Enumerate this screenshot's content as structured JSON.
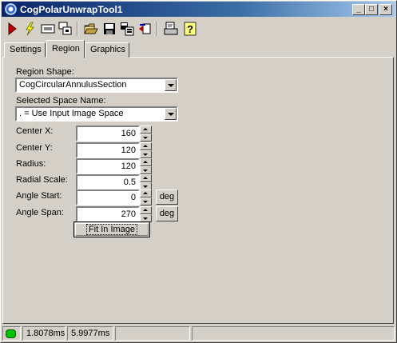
{
  "window": {
    "title": "CogPolarUnwrapTool1"
  },
  "caption_buttons": {
    "minimize": "_",
    "maximize": "□",
    "close": "×"
  },
  "toolbar": {
    "buttons": [
      {
        "name": "run-icon"
      },
      {
        "name": "electric-icon"
      },
      {
        "name": "image-icon"
      },
      {
        "name": "local-display-icon"
      },
      {
        "name": "open-folder-icon"
      },
      {
        "name": "save-icon"
      },
      {
        "name": "save-settings-icon"
      },
      {
        "name": "reset-icon"
      },
      {
        "name": "print-preview-icon"
      },
      {
        "name": "help-icon"
      }
    ]
  },
  "tabs": [
    {
      "label": "Settings",
      "active": false
    },
    {
      "label": "Region",
      "active": true
    },
    {
      "label": "Graphics",
      "active": false
    }
  ],
  "region": {
    "shape_label": "Region Shape:",
    "shape_value": "CogCircularAnnulusSection",
    "space_label": "Selected Space Name:",
    "space_value": ". = Use Input Image Space",
    "fields": [
      {
        "label": "Center X:",
        "value": "160"
      },
      {
        "label": "Center Y:",
        "value": "120"
      },
      {
        "label": "Radius:",
        "value": "120"
      },
      {
        "label": "Radial Scale:",
        "value": "0.5"
      },
      {
        "label": "Angle Start:",
        "value": "0",
        "unit": "deg"
      },
      {
        "label": "Angle Span:",
        "value": "270",
        "unit": "deg"
      }
    ],
    "fit_button": "Fit In Image"
  },
  "status": {
    "indicator_color": "#00c000",
    "time1": "1.8078ms",
    "time2": "5.9977ms"
  }
}
